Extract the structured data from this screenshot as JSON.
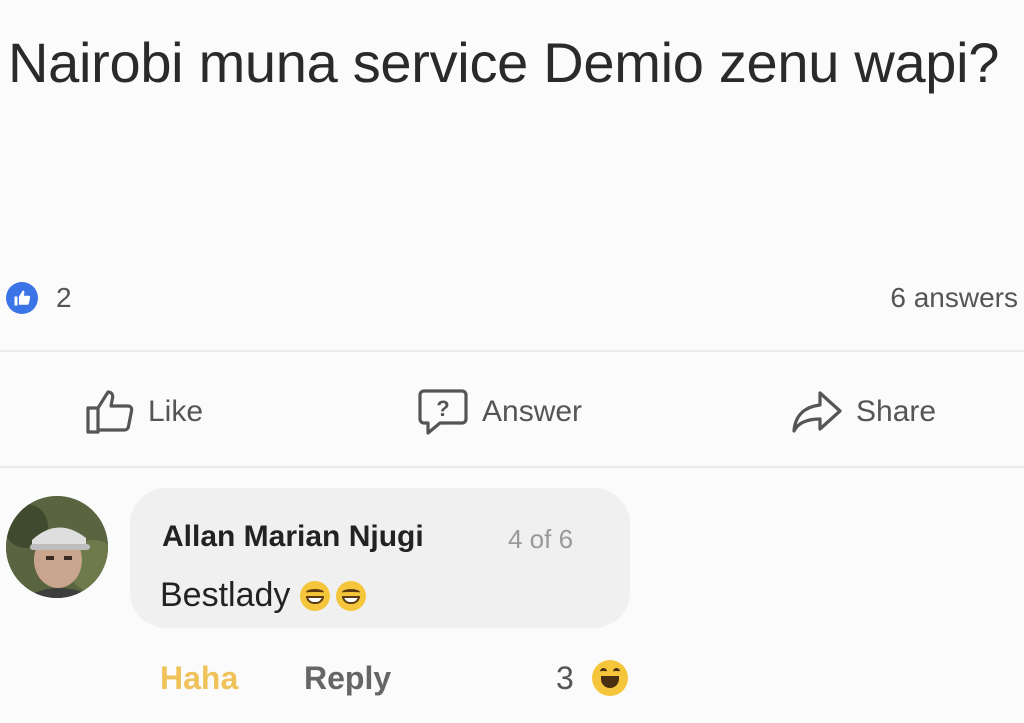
{
  "post": {
    "question": "Nairobi muna service Demio zenu wapi?"
  },
  "stats": {
    "like_count": "2",
    "answers_label": "6 answers"
  },
  "actions": {
    "like_label": "Like",
    "answer_label": "Answer",
    "share_label": "Share"
  },
  "comment": {
    "author": "Allan Marian Njugi",
    "position_label": "4 of 6",
    "text": "Bestlady",
    "reaction_label": "Haha",
    "reply_label": "Reply",
    "reaction_count": "3"
  },
  "colors": {
    "like_badge": "#3b74e6",
    "haha_reaction": "#f0c25a",
    "bubble_bg": "#f0f0f0"
  }
}
